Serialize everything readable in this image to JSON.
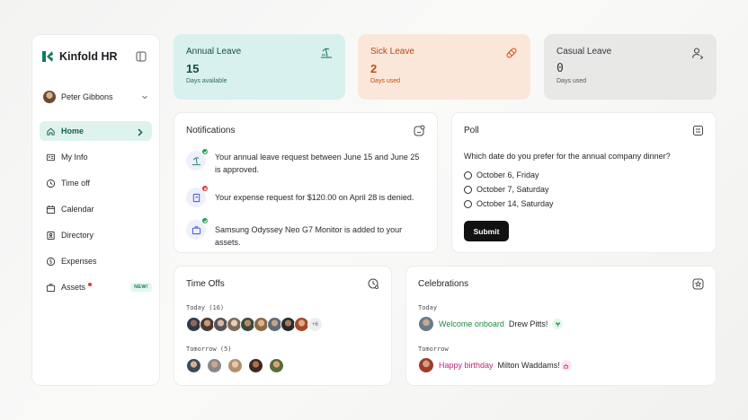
{
  "app": {
    "brand": "Kinfold HR",
    "brand_color": "#0f7d63"
  },
  "user": {
    "name": "Peter Gibbons"
  },
  "nav": {
    "items": [
      {
        "label": "Home",
        "icon": "home-icon",
        "active": true
      },
      {
        "label": "My Info",
        "icon": "id-card-icon"
      },
      {
        "label": "Time off",
        "icon": "clock-icon"
      },
      {
        "label": "Calendar",
        "icon": "calendar-icon"
      },
      {
        "label": "Directory",
        "icon": "directory-icon"
      },
      {
        "label": "Expenses",
        "icon": "dollar-icon"
      },
      {
        "label": "Assets",
        "icon": "briefcase-icon",
        "badge": "NEW!"
      }
    ]
  },
  "stats": {
    "annual": {
      "title": "Annual Leave",
      "value": "15",
      "sub": "Days available",
      "icon": "beach-icon"
    },
    "sick": {
      "title": "Sick Leave",
      "value": "2",
      "sub": "Days used",
      "icon": "bandage-icon"
    },
    "casual": {
      "title": "Casual Leave",
      "value": "0",
      "sub": "Days used",
      "icon": "user-leave-icon"
    }
  },
  "notifications": {
    "title": "Notifications",
    "items": [
      {
        "text": "Your annual leave request between June 15 and June 25 is approved.",
        "status": "approved",
        "icon": "beach-icon"
      },
      {
        "text": "Your expense request for $120.00 on April 28 is denied.",
        "status": "denied",
        "icon": "receipt-icon"
      },
      {
        "text": "Samsung Odyssey Neo G7 Monitor is added to your assets.",
        "status": "approved",
        "icon": "briefcase-icon"
      }
    ]
  },
  "poll": {
    "title": "Poll",
    "question": "Which date do you prefer for the annual company dinner?",
    "options": [
      "October 6, Friday",
      "October 7, Saturday",
      "October 14, Saturday"
    ],
    "submit_label": "Submit"
  },
  "timeoffs": {
    "title": "Time Offs",
    "today_label": "Today (16)",
    "today_more": "+6",
    "tomorrow_label": "Tomorrow (5)"
  },
  "celebrations": {
    "title": "Celebrations",
    "today_label": "Today",
    "today_highlight": "Welcome onboard",
    "today_name": "Drew Pitts!",
    "tomorrow_label": "Tomorrow",
    "tomorrow_highlight": "Happy birthday",
    "tomorrow_name": "Milton Waddams!"
  }
}
